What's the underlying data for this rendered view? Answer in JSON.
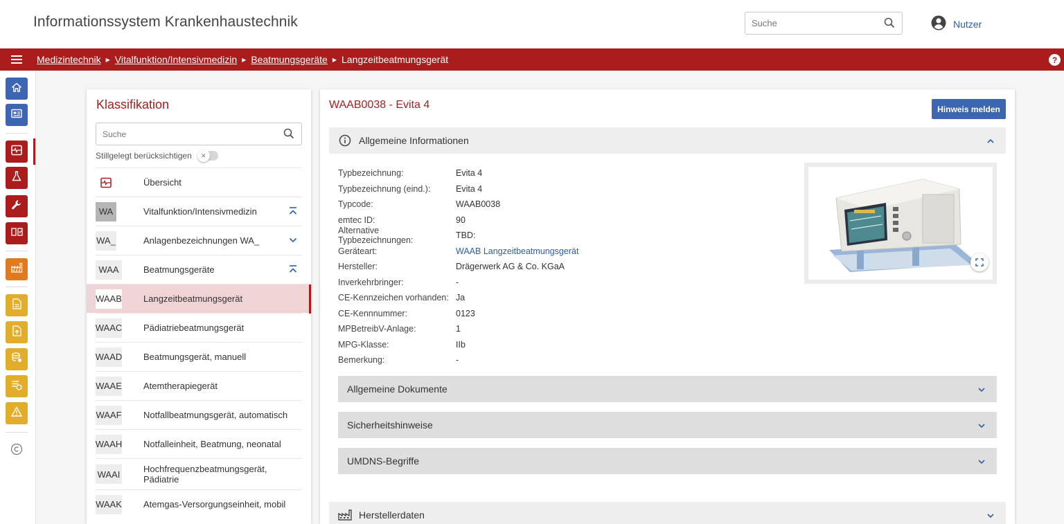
{
  "header": {
    "app_title": "Informationssystem Krankenhaustechnik",
    "search_placeholder": "Suche",
    "user_label": "Nutzer"
  },
  "breadcrumb": {
    "items": [
      "Medizintechnik",
      "Vitalfunktion/Intensivmedizin",
      "Beatmungsgeräte"
    ],
    "current": "Langzeitbeatmungsgerät"
  },
  "leftnav": {
    "icons": [
      "home-icon",
      "id-card-icon",
      "monitor-icon",
      "flask-icon",
      "wrench-icon",
      "book-icon",
      "factory-icon",
      "document-icon",
      "upload-document-icon",
      "database-icon",
      "money-icon",
      "warning-icon",
      "copyright-icon"
    ]
  },
  "classification": {
    "title": "Klassifikation",
    "search_placeholder": "Suche",
    "toggle_label": "Stillgelegt berücksichtigen",
    "overview_label": "Übersicht",
    "items": [
      {
        "code": "WA",
        "label": "Vitalfunktion/Intensivmedizin"
      },
      {
        "code": "WA_",
        "label": "Anlagenbezeichnungen WA_"
      },
      {
        "code": "WAA",
        "label": "Beatmungsgeräte"
      },
      {
        "code": "WAAB",
        "label": "Langzeitbeatmungsgerät"
      },
      {
        "code": "WAAC",
        "label": "Pädiatriebeatmungsgerät"
      },
      {
        "code": "WAAD",
        "label": "Beatmungsgerät, manuell"
      },
      {
        "code": "WAAE",
        "label": "Atemtherapiegerät"
      },
      {
        "code": "WAAF",
        "label": "Notfallbeatmungsgerät, automatisch"
      },
      {
        "code": "WAAH",
        "label": "Notfalleinheit, Beatmung, neonatal"
      },
      {
        "code": "WAAI",
        "label": "Hochfrequenzbeatmungsgerät, Pädiatrie"
      },
      {
        "code": "WAAK",
        "label": "Atemgas-Versorgungseinheit, mobil"
      }
    ]
  },
  "detail": {
    "title": "WAAB0038 - Evita 4",
    "report_button": "Hinweis melden",
    "general_section": "Allgemeine Informationen",
    "properties": [
      {
        "key": "Typbezeichnung:",
        "value": "Evita 4"
      },
      {
        "key": "Typbezeichnung (eind.):",
        "value": "Evita 4"
      },
      {
        "key": "Typcode:",
        "value": "WAAB0038"
      },
      {
        "key": "emtec ID:",
        "value": "90"
      },
      {
        "key": "Alternative Typbezeichnungen:",
        "value": "TBD:"
      },
      {
        "key": "Geräteart:",
        "value": "WAAB Langzeitbeatmungsgerät"
      },
      {
        "key": "Hersteller:",
        "value": "Drägerwerk AG & Co. KGaA"
      },
      {
        "key": "Inverkehrbringer:",
        "value": "-"
      },
      {
        "key": "CE-Kennzeichen vorhanden:",
        "value": "Ja"
      },
      {
        "key": "CE-Kennnummer:",
        "value": "0123"
      },
      {
        "key": "MPBetreibV-Anlage:",
        "value": "1"
      },
      {
        "key": "MPG-Klasse:",
        "value": "IIb"
      },
      {
        "key": "Bemerkung:",
        "value": "-"
      }
    ],
    "subsections": [
      "Allgemeine Dokumente",
      "Sicherheitshinweise",
      "UMDNS-Begriffe"
    ],
    "manufacturer_section": "Herstellerdaten"
  },
  "colors": {
    "brand_red": "#ab1d1d",
    "link_blue": "#2f5da8",
    "button_blue": "#3c66b1"
  }
}
